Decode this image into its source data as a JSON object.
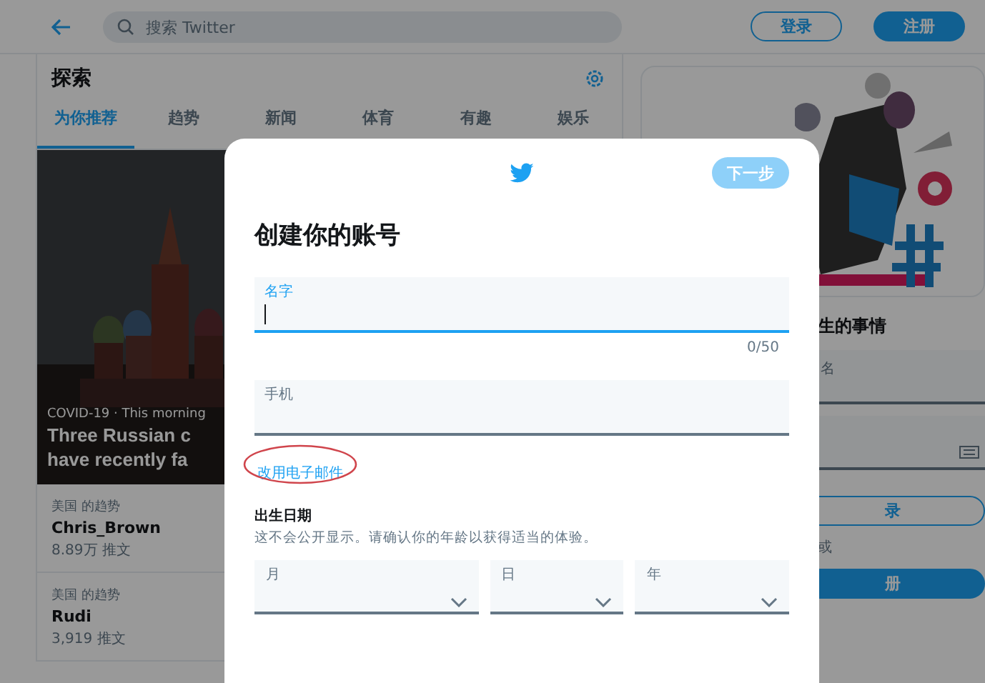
{
  "top_bar": {
    "search": {
      "placeholder": "搜索 Twitter"
    },
    "login_button": "登录",
    "signup_button": "注册"
  },
  "explore": {
    "title": "探索",
    "tabs": [
      {
        "label": "为你推荐",
        "selected": true
      },
      {
        "label": "趋势",
        "selected": false
      },
      {
        "label": "新闻",
        "selected": false
      },
      {
        "label": "体育",
        "selected": false
      },
      {
        "label": "有趣",
        "selected": false
      },
      {
        "label": "娱乐",
        "selected": false
      }
    ],
    "hero": {
      "kind": "picture",
      "meta": "COVID-19 · This morning",
      "headline_lines": [
        "Three Russian c",
        "have recently fa"
      ]
    },
    "trends": [
      {
        "context": "美国 的趋势",
        "name": "Chris_Brown",
        "count": "8.89万 推文"
      },
      {
        "context": "美国 的趋势",
        "name": "Rudi",
        "count": "3,919 推文"
      }
    ]
  },
  "side_panel": {
    "heading": "生的事情",
    "username_placeholder": "名",
    "login_button": "录",
    "or_text": "或",
    "signup_button": "册"
  },
  "modal": {
    "next_button": {
      "label": "下一步",
      "disabled": true
    },
    "title": "创建你的账号",
    "fields": [
      {
        "label": "名字",
        "focused": true,
        "counter": "0/50"
      },
      {
        "label": "手机",
        "focused": false
      }
    ],
    "switch_link": {
      "label": "改用电子邮件",
      "circled": true
    },
    "birth_date": {
      "title": "出生日期",
      "hint": "这不会公开显示。请确认你的年龄以获得适当的体验。",
      "selects": [
        {
          "label": "月"
        },
        {
          "label": "日"
        },
        {
          "label": "年"
        }
      ]
    }
  }
}
